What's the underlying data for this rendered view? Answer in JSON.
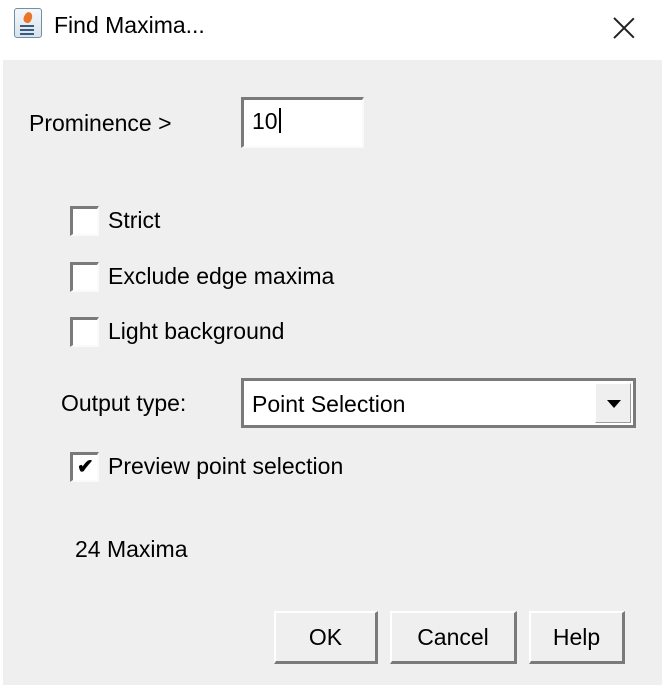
{
  "window": {
    "title": "Find Maxima...",
    "icon": "java-app-icon",
    "close_icon": "close-icon"
  },
  "prominence": {
    "label": "Prominence >",
    "value": "10"
  },
  "checkboxes": [
    {
      "label": "Strict",
      "checked": false
    },
    {
      "label": "Exclude edge maxima",
      "checked": false
    },
    {
      "label": "Light background",
      "checked": false
    }
  ],
  "output_type": {
    "label": "Output type:",
    "selected": "Point Selection"
  },
  "preview": {
    "label": "Preview point selection",
    "checked": true,
    "check_glyph": "✔"
  },
  "status": {
    "maxima_count": "24 Maxima"
  },
  "buttons": {
    "ok": "OK",
    "cancel": "Cancel",
    "help": "Help"
  }
}
